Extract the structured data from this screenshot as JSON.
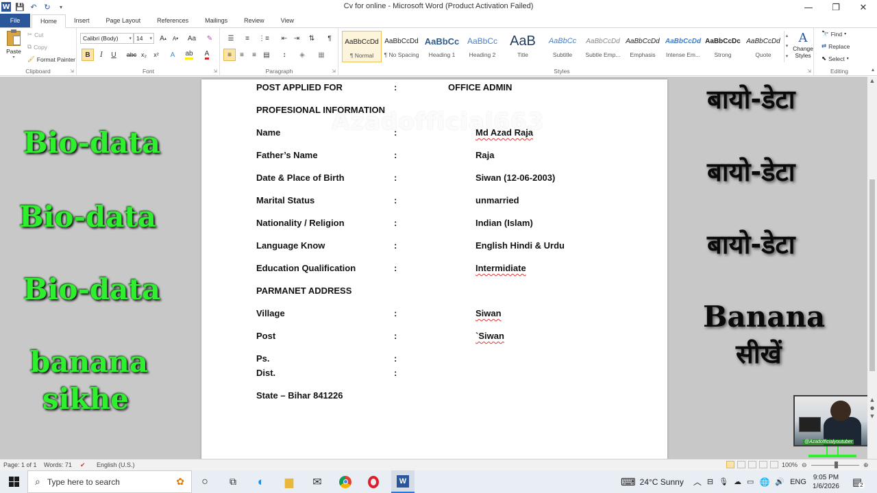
{
  "window": {
    "title": "Cv for online  -  Microsoft Word (Product Activation Failed)",
    "minimize": "—",
    "maximize": "❐",
    "close": "✕"
  },
  "ribbon_tabs": [
    "File",
    "Home",
    "Insert",
    "Page Layout",
    "References",
    "Mailings",
    "Review",
    "View"
  ],
  "clipboard": {
    "paste": "Paste",
    "cut": "Cut",
    "copy": "Copy",
    "format_painter": "Format Painter",
    "label": "Clipboard"
  },
  "font": {
    "family": "Calibri (Body)",
    "size": "14",
    "label": "Font"
  },
  "paragraph": {
    "label": "Paragraph"
  },
  "styles": {
    "label": "Styles",
    "items": [
      {
        "sample": "AaBbCcDd",
        "name": "¶ Normal"
      },
      {
        "sample": "AaBbCcDd",
        "name": "¶ No Spacing"
      },
      {
        "sample": "AaBbCc",
        "name": "Heading 1"
      },
      {
        "sample": "AaBbCc",
        "name": "Heading 2"
      },
      {
        "sample": "AaB",
        "name": "Title"
      },
      {
        "sample": "AaBbCc",
        "name": "Subtitle"
      },
      {
        "sample": "AaBbCcDd",
        "name": "Subtle Emp..."
      },
      {
        "sample": "AaBbCcDd",
        "name": "Emphasis"
      },
      {
        "sample": "AaBbCcDd",
        "name": "Intense Em..."
      },
      {
        "sample": "AaBbCcDc",
        "name": "Strong"
      },
      {
        "sample": "AaBbCcDd",
        "name": "Quote"
      }
    ],
    "change_styles": "Change Styles"
  },
  "editing": {
    "find": "Find",
    "replace": "Replace",
    "select": "Select",
    "label": "Editing"
  },
  "document": {
    "watermark": "Azadofficial663",
    "post_row": {
      "label": "POST APPLIED FOR",
      "colon": ":",
      "value": "OFFICE ADMIN"
    },
    "section1": "PROFESIONAL INFORMATION",
    "rows": [
      {
        "label": "Name",
        "colon": ":",
        "value": "Md Azad Raja"
      },
      {
        "label": "Father’s Name",
        "colon": ":",
        "value": "Raja"
      },
      {
        "label": "Date & Place of Birth",
        "colon": ":",
        "value": "Siwan (12-06-2003)"
      },
      {
        "label": "Marital Status",
        "colon": ":",
        "value": "unmarried"
      },
      {
        "label": "Nationality / Religion",
        "colon": ":",
        "value": "Indian (Islam)"
      },
      {
        "label": "Language Know",
        "colon": ":",
        "value": "English Hindi & Urdu"
      },
      {
        "label": "Education Qualification",
        "colon": ":",
        "value": "Intermidiate"
      }
    ],
    "section2": "PARMANET ADDRESS",
    "address_rows": [
      {
        "label": "Village",
        "colon": ":",
        "value": "Siwan"
      },
      {
        "label": "Post",
        "colon": ":",
        "value": "`Siwan"
      },
      {
        "label": "Ps.",
        "colon": ":",
        "value": ""
      },
      {
        "label": "Dist.",
        "colon": ":",
        "value": ""
      }
    ],
    "state": "State – Bihar 841226"
  },
  "overlay_left": [
    "Bio-data",
    "Bio-data",
    "Bio-data",
    "banana",
    "sikhe"
  ],
  "overlay_right": [
    "बायो-डेटा",
    "बायो-डेटा",
    "बायो-डेटा",
    "Banana",
    "सीखें"
  ],
  "webcam_tag": "@Azadofficialyoutuber",
  "statusbar": {
    "page": "Page: 1 of 1",
    "words": "Words: 71",
    "language": "English (U.S.)",
    "zoom": "100%"
  },
  "taskbar": {
    "search_placeholder": "Type here to search",
    "weather": "24°C  Sunny",
    "lang": "ENG",
    "time": "9:05 PM",
    "date": "1/6/2026",
    "notif_count": "2"
  }
}
